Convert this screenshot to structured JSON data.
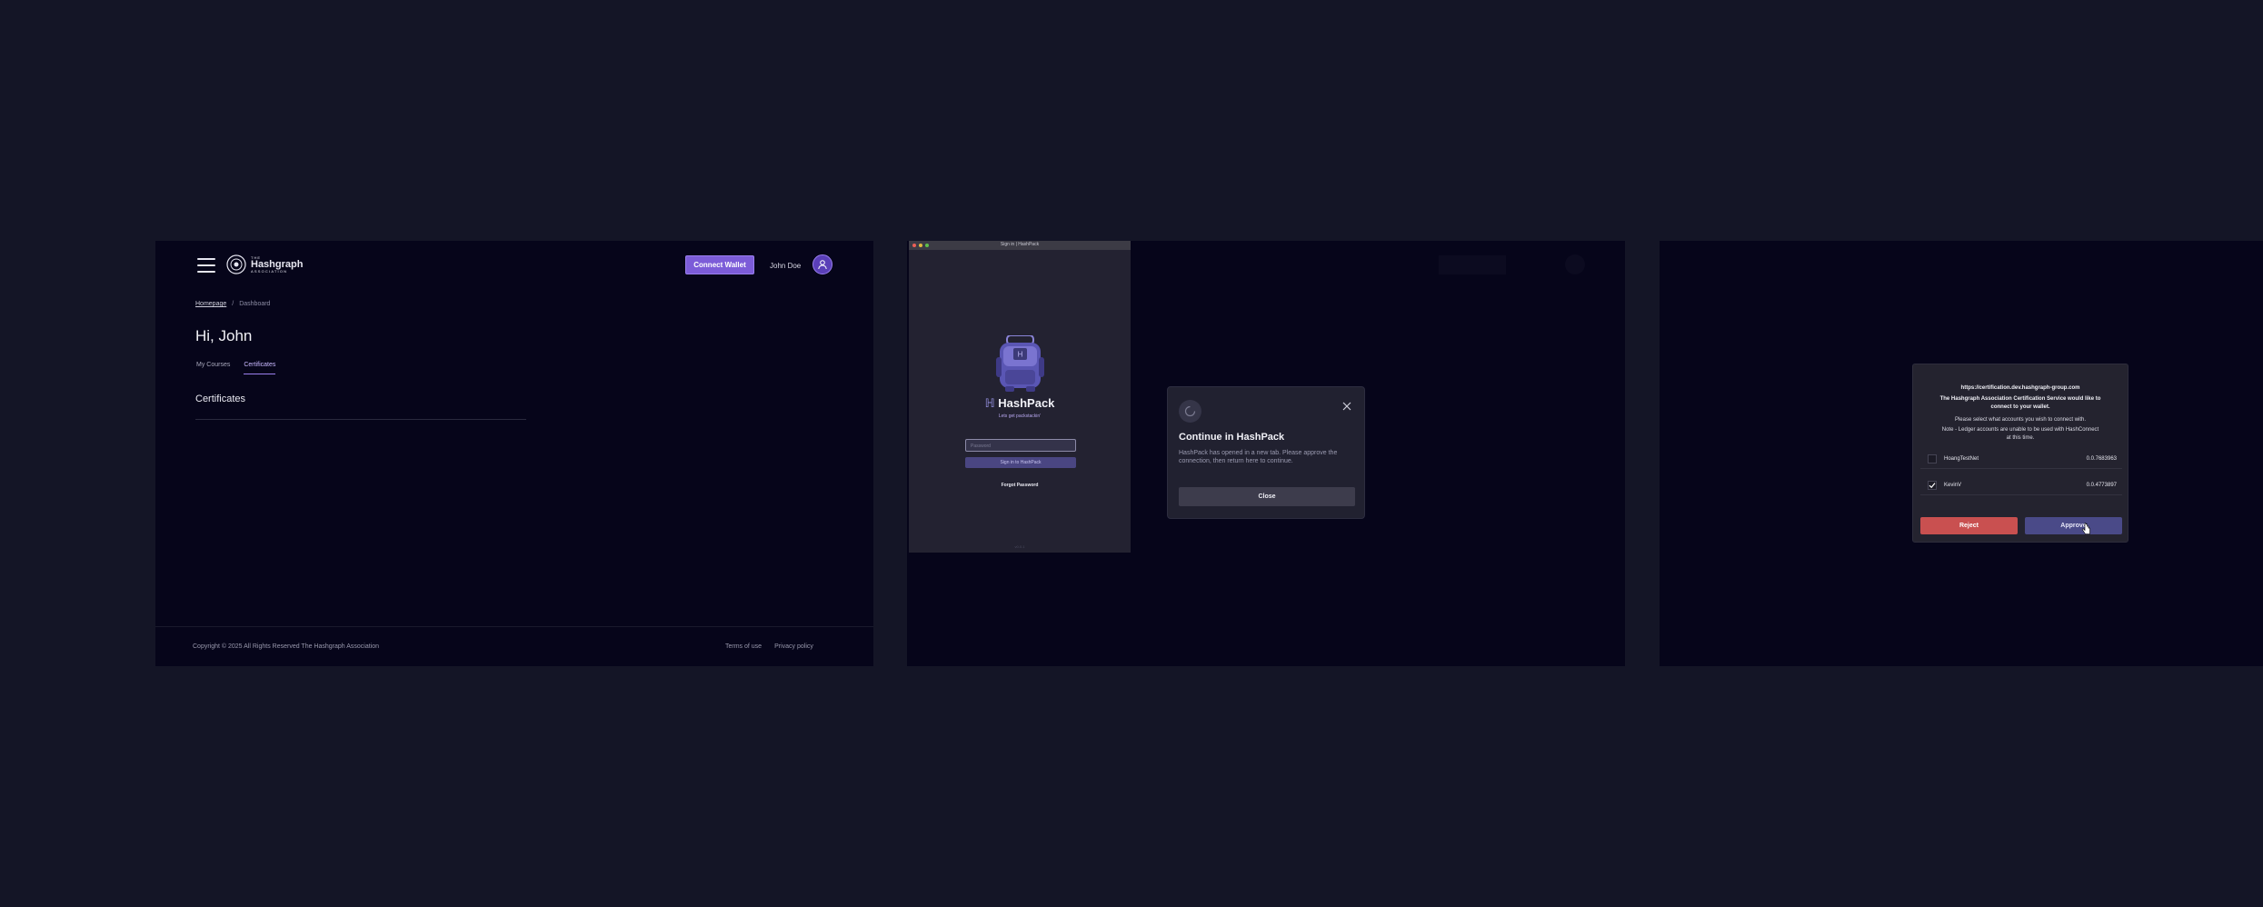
{
  "panel1": {
    "logo": {
      "line1": "THE",
      "line2": "Hashgraph",
      "line3": "ASSOCIATION"
    },
    "connect_label": "Connect Wallet",
    "user_name": "John Doe",
    "breadcrumb": {
      "home": "Homepage",
      "separator": "/",
      "current": "Dashboard"
    },
    "greeting": "Hi, John",
    "tabs": [
      {
        "label": "My Courses"
      },
      {
        "label": "Certificates"
      }
    ],
    "section_title": "Certificates",
    "footer": {
      "copyright": "Copyright © 2025 All Rights Reserved The Hashgraph Association",
      "terms": "Terms of use",
      "privacy": "Privacy policy"
    }
  },
  "panel2": {
    "hashpack": {
      "window_title": "Sign in | HashPack",
      "brand": "HashPack",
      "tagline": "Lets get packstackin'",
      "password_placeholder": "Password",
      "signin_label": "Sign in to HashPack",
      "forgot_label": "Forgot Password",
      "version": "v0.0.1"
    },
    "modal": {
      "title": "Continue in HashPack",
      "text": "HashPack has opened in a new tab. Please approve the connection, then return here to continue.",
      "close_label": "Close"
    }
  },
  "panel3": {
    "url": "https://certification.dev.hashgraph-group.com",
    "request_line1": "The Hashgraph Association Certification Service would like to",
    "request_line2": "connect to your wallet.",
    "select_text": "Please select what accounts you wish to connect with.",
    "note_line1": "Note - Ledger accounts are unable to be used with HashConnect",
    "note_line2": "at this time.",
    "accounts": [
      {
        "name": "HoangTestNet",
        "id": "0.0.7683963",
        "checked": false
      },
      {
        "name": "KevinV",
        "id": "0.0.4773897",
        "checked": true
      }
    ],
    "reject_label": "Reject",
    "approve_label": "Approve"
  },
  "colors": {
    "background": "#141526",
    "panel": "#06051a",
    "accent": "#7c5cd8",
    "reject": "#c95050",
    "approve": "#4a4a88"
  },
  "icons": [
    "menu-icon",
    "hashgraph-logo-icon",
    "user-icon",
    "hashpack-mascot-icon",
    "close-icon",
    "spinner-icon",
    "checkmark-icon",
    "cursor-icon"
  ]
}
